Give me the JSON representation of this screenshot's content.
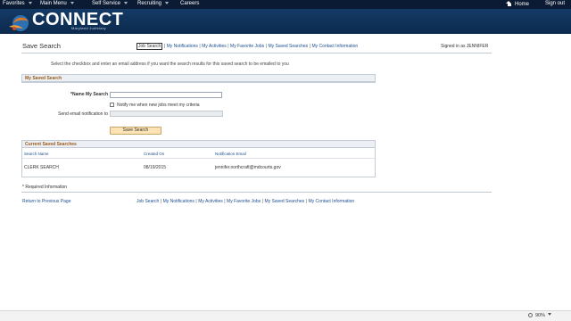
{
  "topnav": {
    "favorites": "Favorites",
    "main_menu": "Main Menu",
    "self_service": "Self Service",
    "recruiting": "Recruiting",
    "careers": "Careers",
    "home": "Home",
    "sign_out": "Sign out"
  },
  "banner": {
    "brand": "CONNECT",
    "subtitle": "Maryland Judiciary"
  },
  "page": {
    "title": "Save Search",
    "signed_in": "Signed in as JENNIFER",
    "instruction": "Select the checkbox and enter an email address if you want the search results for this saved search to be emailed to you"
  },
  "links": [
    "Job Search",
    "My Notifications",
    "My Activities",
    "My Favorite Jobs",
    "My Saved Searches",
    "My Contact Information"
  ],
  "saved_search": {
    "header": "My Saved Search",
    "name_label": "*Name My Search",
    "name_value": "",
    "notify_label": "Notify me when new jobs meet my criteria",
    "notify_checked": false,
    "email_label": "Send email notification to",
    "email_value": "",
    "save_button": "Save Search"
  },
  "current": {
    "header": "Current Saved Searches",
    "columns": [
      "Search Name",
      "Created On",
      "Notification Email"
    ],
    "rows": [
      [
        "CLERK SEARCH",
        "08/19/2015",
        "jennifer.northcraft@mdcourts.gov"
      ]
    ]
  },
  "footer": {
    "required_note": "* Required Information",
    "return_link": "Return to Previous Page"
  },
  "status": {
    "zoom": "90%"
  },
  "colors": {
    "nav_bg": "#0b1b33",
    "banner_bg": "#143a66",
    "link": "#1c4f8f",
    "group_header_text": "#9a5a1a",
    "button_bg": "#fbe3b3"
  }
}
